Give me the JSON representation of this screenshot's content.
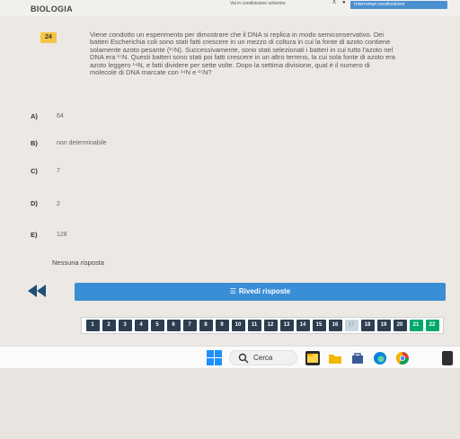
{
  "header": {
    "subject": "BIOLOGIA",
    "share_link": "Vai in condivisione schermo",
    "close_mark": "X",
    "dot_mark": "●",
    "interrupt_label": "Interrompi condivisione"
  },
  "question": {
    "number": "24",
    "lines": [
      "Viene condotto un esperimento per dimostrare che il DNA si replica in modo semiconservativo. Dei",
      "batteri Escherichia coli sono stati fatti crescere in un mezzo di coltura in cui la fonte di azoto contiene",
      "solamente azoto pesante (¹⁵N). Successivamente, sono stati selezionati i batteri in cui tutto l'azoto nel",
      "DNA era ¹⁵N. Questi batteri sono stati poi fatti crescere in un altro terreno, la cui sola fonte di azoto era",
      "azoto leggero ¹⁴N, e fatti dividere per sette volte. Dopo la settima divisione, qual è il numero di",
      "molecole di DNA marcate con ¹⁴N e ¹⁵N?"
    ]
  },
  "options": [
    {
      "letter": "A)",
      "text": "64"
    },
    {
      "letter": "B)",
      "text": "non determinabile"
    },
    {
      "letter": "C)",
      "text": "7"
    },
    {
      "letter": "D)",
      "text": "2"
    },
    {
      "letter": "E)",
      "text": "128"
    }
  ],
  "no_answer": "Nessuna risposta",
  "review_button": "Rivedi risposte",
  "nav_numbers": [
    "1",
    "2",
    "3",
    "4",
    "5",
    "6",
    "7",
    "8",
    "9",
    "10",
    "11",
    "12",
    "13",
    "14",
    "15",
    "16",
    "17",
    "18",
    "19",
    "20",
    "21",
    "22"
  ],
  "nav_current": "17",
  "nav_green": [
    "21",
    "22"
  ],
  "taskbar": {
    "search_label": "Cerca"
  },
  "colors": {
    "accent_blue": "#3a8ed5",
    "nav_dark": "#2c3e50",
    "nav_green": "#00a86b",
    "question_badge": "#f6c342"
  },
  "icons": [
    "back-double-arrow-icon",
    "list-icon",
    "windows-start-icon",
    "search-icon",
    "file-explorer-icon",
    "folder-icon",
    "store-icon",
    "edge-icon",
    "chrome-icon"
  ]
}
